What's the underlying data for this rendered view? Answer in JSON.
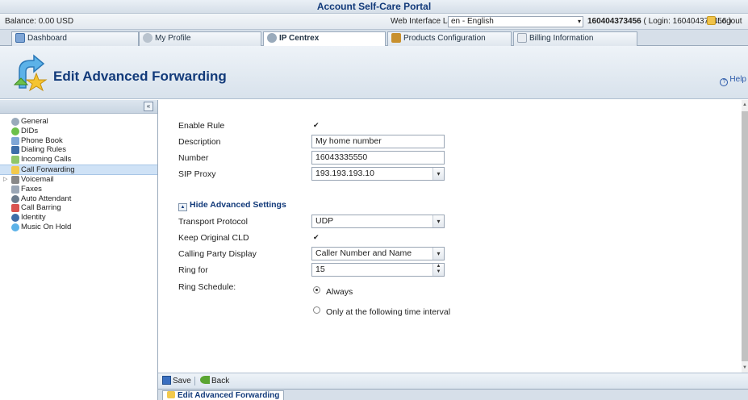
{
  "window": {
    "title": "Account Self-Care Portal"
  },
  "info": {
    "balance": "Balance: 0.00 USD",
    "language_label": "Web Interface Language:",
    "language_value": "en - English",
    "account_id": "160404373456",
    "login_text": "( Login: 160404373456 )",
    "logout": "Logout"
  },
  "tabs": [
    {
      "label": "Dashboard"
    },
    {
      "label": "My Profile"
    },
    {
      "label": "IP Centrex"
    },
    {
      "label": "Products Configuration"
    },
    {
      "label": "Billing Information"
    }
  ],
  "header": {
    "title": "Edit Advanced Forwarding",
    "help": "Help"
  },
  "sidebar": {
    "collapse_glyph": "«",
    "items": [
      {
        "label": "General"
      },
      {
        "label": "DIDs"
      },
      {
        "label": "Phone Book"
      },
      {
        "label": "Dialing Rules"
      },
      {
        "label": "Incoming Calls"
      },
      {
        "label": "Call Forwarding"
      },
      {
        "label": "Voicemail"
      },
      {
        "label": "Faxes"
      },
      {
        "label": "Auto Attendant"
      },
      {
        "label": "Call Barring"
      },
      {
        "label": "Identity"
      },
      {
        "label": "Music On Hold"
      }
    ]
  },
  "form": {
    "enable_rule": {
      "label": "Enable Rule",
      "checked": true
    },
    "description": {
      "label": "Description",
      "value": "My home number"
    },
    "number": {
      "label": "Number",
      "value": "16043335550"
    },
    "sip_proxy": {
      "label": "SIP Proxy",
      "value": "193.193.193.10"
    },
    "advanced_toggle": "Hide Advanced Settings",
    "transport_protocol": {
      "label": "Transport Protocol",
      "value": "UDP"
    },
    "keep_original_cld": {
      "label": "Keep Original CLD",
      "checked": true
    },
    "calling_party_display": {
      "label": "Calling Party Display",
      "value": "Caller Number and Name"
    },
    "ring_for": {
      "label": "Ring for",
      "value": "15"
    },
    "ring_schedule": {
      "label": "Ring Schedule:",
      "options": [
        {
          "label": "Always",
          "selected": true
        },
        {
          "label": "Only at the following time interval",
          "selected": false
        }
      ]
    }
  },
  "toolbar": {
    "save": "Save",
    "back": "Back"
  },
  "bottom_tab": {
    "label": "Edit Advanced Forwarding"
  },
  "icons": {
    "check": "✔",
    "dropdown": "▾",
    "spin": "▲▼",
    "collapse_triangle": "▲",
    "expander": "▷"
  }
}
